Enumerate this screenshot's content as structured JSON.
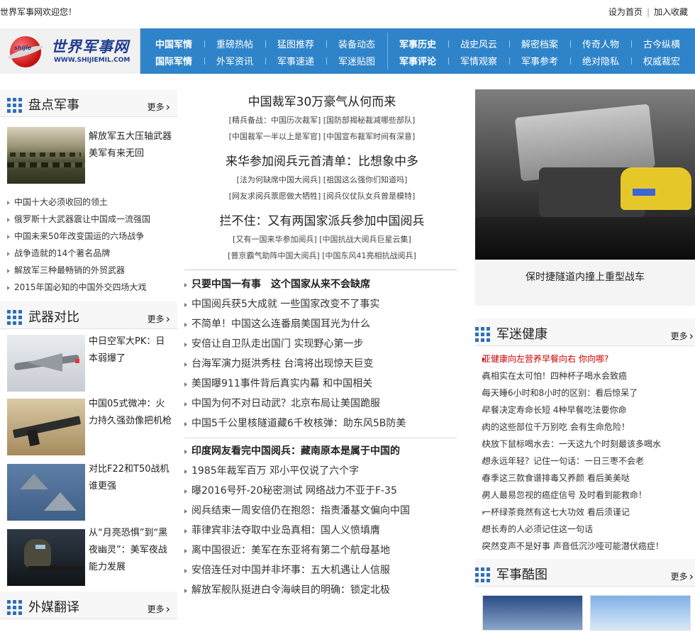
{
  "topbar": {
    "welcome": "世界军事网欢迎您！",
    "set_home": "设为首页",
    "favorite": "加入收藏",
    "sep": "|"
  },
  "logo": {
    "name": "世界军事网",
    "url": "WWW.SHIJIEMIL.COM",
    "globe_text": "shijie"
  },
  "nav": {
    "group1": {
      "row1": [
        "中国军情",
        "重磅热帖",
        "猛图推荐",
        "装备动态"
      ],
      "row2": [
        "国际军情",
        "外军资讯",
        "军事速递",
        "军迷贴图"
      ]
    },
    "group2": {
      "row1": [
        "军事历史",
        "战史风云",
        "解密档案",
        "传奇人物",
        "古今纵横"
      ],
      "row2": [
        "军事评论",
        "军情观察",
        "军事参考",
        "绝对隐私",
        "权威裁宏"
      ]
    }
  },
  "left": {
    "s1": {
      "title": "盘点军事",
      "more": "更多",
      "feature": "解放军五大压轴武器 美军有来无回",
      "list": [
        "中国十大必须收回的领土",
        "俄罗斯十大武器震让中国成一流强国",
        "中国未来50年改变国运的六场战争",
        "战争造就的14个著名品牌",
        "解放军三种最畅销的外贸武器",
        "2015年国必知的中国外交四场大戏"
      ]
    },
    "s2": {
      "title": "武器对比",
      "more": "更多",
      "features": [
        "中日空军大PK：日本弱爆了",
        "中国05式微冲：火力持久强劲像把机枪",
        "对比F22和T50战机谁更强",
        "从“月亮恐惧”到“黑夜幽灵”：美军夜战能力发展"
      ]
    },
    "s3": {
      "title": "外媒翻译",
      "more": "更多"
    }
  },
  "mid": {
    "blocks": [
      {
        "headline": "中国裁军30万豪气从何而来",
        "subs": [
          "[精兵备战：中国历次裁军] [国防部揭秘裁减哪些部队]",
          "[中国裁军一半以上是军官] [中国宣布裁军时间有深意]"
        ]
      },
      {
        "headline": "来华参加阅兵元首清单：比想象中多",
        "subs": [
          "[法为何缺席中国大阅兵] [祖国这么强你们知道吗]",
          "[网友求阅兵票愿做大牺牲] [阅兵仪仗队女兵曾是模特]"
        ]
      },
      {
        "headline": "拦不住：又有两国家派兵参加中国阅兵",
        "subs": [
          "[又有一国来华参加阅兵] [中国抗战大阅兵巨星云集]",
          "[普京霸气助阵中国大阅兵] [中国东风41亮相抗战阅兵]"
        ]
      }
    ],
    "list1": [
      {
        "t": "只要中国一有事　这个国家从来不会缺席",
        "b": true
      },
      {
        "t": "中国阅兵获5大成就 一些国家改变不了事实"
      },
      {
        "t": "不简单！中国这么连番扇美国耳光为什么"
      },
      {
        "t": "安倍让自卫队走出国门 实现野心第一步"
      },
      {
        "t": "台海军演力挺洪秀柱 台湾将出现惊天巨变"
      },
      {
        "t": "美国曝911事件背后真实内幕 和中国相关"
      },
      {
        "t": "中国为何不对日动武？北京布局让美国跪服"
      },
      {
        "t": "中国5千公里核隧道藏6千枚核弹：助东风5B防美"
      }
    ],
    "list2": [
      {
        "t": "印度网友看完中国阅兵：藏南原本是属于中国的",
        "b": true
      },
      {
        "t": "1985年裁军百万 邓小平仅说了六个字"
      },
      {
        "t": "曝2016号歼-20秘密测试 网络战力不亚于F-35"
      },
      {
        "t": "阅兵结束一周安倍仍在抱怨：指责潘基文偏向中国"
      },
      {
        "t": "菲律宾非法夺取中业岛真相：国人义愤填膺"
      },
      {
        "t": "离中国很近：美军在东亚将有第二个航母基地"
      },
      {
        "t": "安倍连任对中国并非坏事：五大机遇让人信服"
      },
      {
        "t": "解放军舰队挺进白令海峡目的明确：锁定北极"
      }
    ]
  },
  "right": {
    "caption": "保时捷隧道内撞上重型战车",
    "s1": {
      "title": "军迷健康",
      "more": "更多",
      "list": [
        {
          "t": "亚健康向左营养早餐向右 你向哪?",
          "red": true
        },
        {
          "t": "真相实在太可怕！四种杯子喝水会致癌"
        },
        {
          "t": "每天睡6小时和8小时的区别：看后惊呆了"
        },
        {
          "t": "早餐决定寿命长短 4种早餐吃法要你命"
        },
        {
          "t": "肉的这些部位千万别吃 会有生命危险！"
        },
        {
          "t": "快放下鼠标喝水去：一天这九个时刻最该多喝水"
        },
        {
          "t": "想永远年轻？记住一句话：一日三枣不会老"
        },
        {
          "t": "春季这三款食谱排毒又养颜 看后美美哒"
        },
        {
          "t": "男人最易忽视的癌症信号 及时看到能救命！"
        },
        {
          "t": "一杯绿茶竟然有这七大功效 看后须谨记"
        },
        {
          "t": "想长寿的人必须记住这一句话"
        },
        {
          "t": "突然变声不是好事 声音低沉沙哑可能潜伏癌症！"
        }
      ]
    },
    "s2": {
      "title": "军事酷图",
      "more": "更多"
    }
  }
}
